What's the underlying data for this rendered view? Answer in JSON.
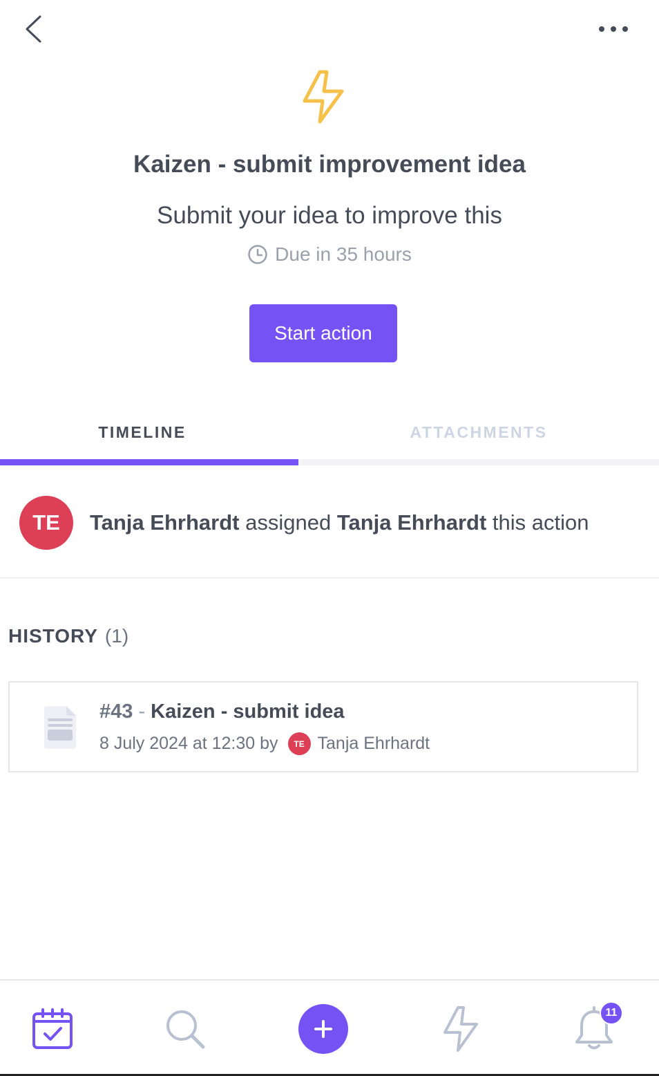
{
  "header": {
    "back_icon": "chevron-left-icon",
    "more_icon": "more-horizontal-icon"
  },
  "action": {
    "icon": "lightning-icon",
    "icon_color": "#f5c14b",
    "title": "Kaizen - submit improvement idea",
    "description": "Submit your idea to improve this",
    "due_icon": "clock-icon",
    "due_text": "Due in 35 hours",
    "start_label": "Start action",
    "accent_color": "#7552f3"
  },
  "tabs": [
    {
      "label": "TIMELINE",
      "active": true
    },
    {
      "label": "ATTACHMENTS",
      "active": false
    }
  ],
  "timeline": {
    "avatar_initials": "TE",
    "avatar_color": "#dd3f56",
    "actor": "Tanja Ehrhardt",
    "verb": "assigned",
    "target": "Tanja Ehrhardt",
    "suffix": "this action"
  },
  "history": {
    "label": "HISTORY",
    "count": "(1)",
    "items": [
      {
        "icon": "document-icon",
        "number": "#43",
        "separator": " - ",
        "name": "Kaizen - submit idea",
        "date_text": "8 July 2024 at 12:30 by",
        "user_initials": "TE",
        "user_name": "Tanja Ehrhardt"
      }
    ]
  },
  "bottom_nav": {
    "items": [
      {
        "icon": "calendar-check-icon",
        "active": true
      },
      {
        "icon": "search-icon",
        "active": false
      },
      {
        "icon": "plus-icon",
        "active": false
      },
      {
        "icon": "lightning-icon",
        "active": false
      },
      {
        "icon": "bell-icon",
        "active": false
      }
    ],
    "notifications_badge": "11"
  }
}
